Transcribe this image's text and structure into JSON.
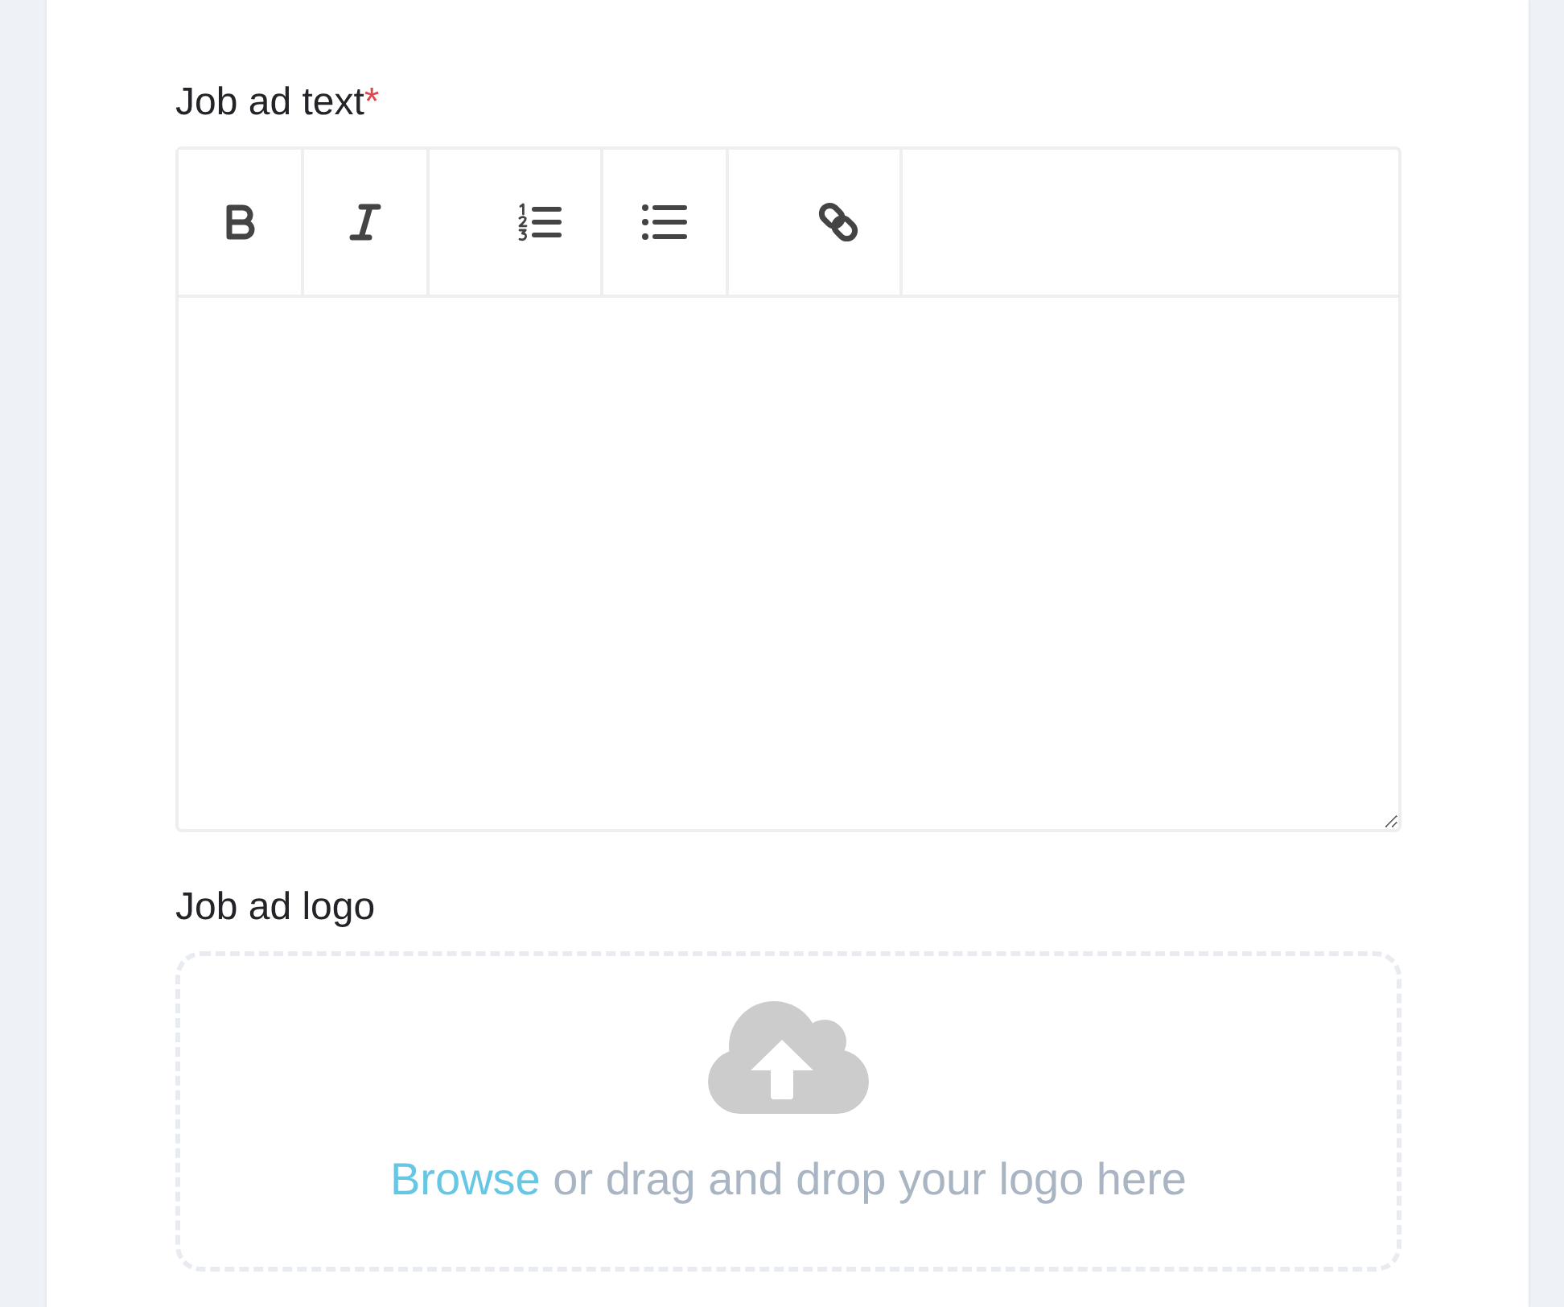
{
  "editor": {
    "label": "Job ad text",
    "required_mark": "*"
  },
  "logo_upload": {
    "label": "Job ad logo",
    "link": "Browse",
    "prompt": "or drag and drop your logo here"
  }
}
